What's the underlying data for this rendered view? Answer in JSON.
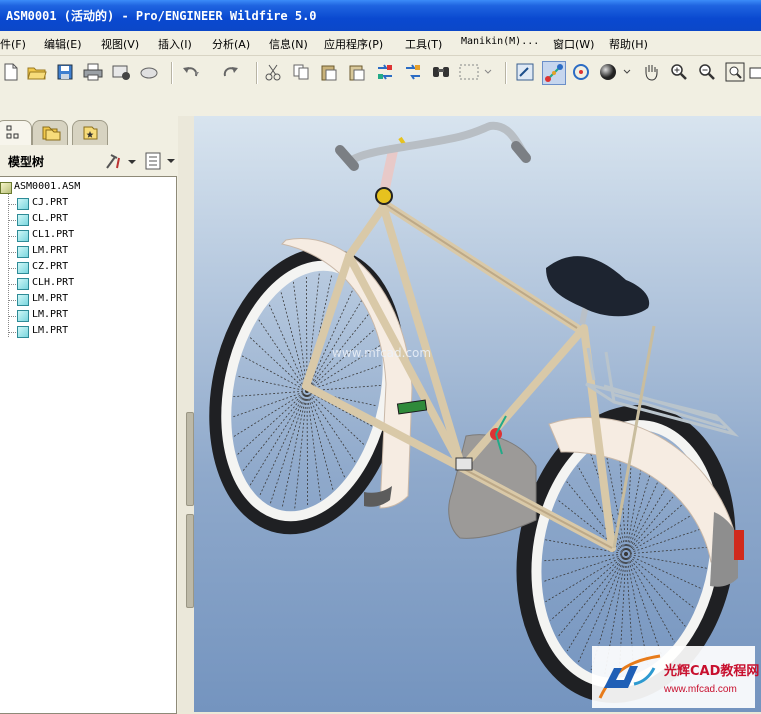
{
  "window": {
    "title": "ASM0001 (活动的) - Pro/ENGINEER Wildfire 5.0"
  },
  "menu": {
    "file": "件(F)",
    "edit": "编辑(E)",
    "view": "视图(V)",
    "insert": "插入(I)",
    "analysis": "分析(A)",
    "info": "信息(N)",
    "applications": "应用程序(P)",
    "tools": "工具(T)",
    "manikin": "Manikin(M)...",
    "window": "窗口(W)",
    "help": "帮助(H)"
  },
  "toolbar": {
    "icons": [
      "new-file-icon",
      "open-folder-icon",
      "save-icon",
      "print-icon",
      "send-mail-icon",
      "regenerate-icon",
      "undo-icon",
      "redo-icon",
      "cut-icon",
      "copy-icon",
      "paste-icon",
      "paste-special-icon",
      "regenerate-model-icon",
      "regenerate-manager-icon",
      "find-icon",
      "select-box-icon",
      "repaint-icon",
      "spin-center-icon",
      "orient-mode-icon",
      "shading-icon",
      "pan-icon",
      "zoom-in-icon",
      "zoom-out-icon",
      "refit-icon",
      "saved-views-icon"
    ]
  },
  "model_tree": {
    "header": "模型树",
    "root": "ASM0001.ASM",
    "items": [
      "CJ.PRT",
      "CL.PRT",
      "CL1.PRT",
      "LM.PRT",
      "CZ.PRT",
      "CLH.PRT",
      "LM.PRT",
      "LM.PRT",
      "LM.PRT"
    ]
  },
  "graphics": {
    "watermark": "www.mfcad.com",
    "logo_name": "光辉CAD教程网",
    "logo_url": "www.mfcad.com"
  },
  "colors": {
    "titlebar": "#0b47c8",
    "frame": "#d9c9a8",
    "saddle": "#1d2430",
    "rim": "#f4f4f2",
    "tire": "#1f2023",
    "viewport_top": "#d8e4ef",
    "viewport_bottom": "#7494bf",
    "logo_red": "#c8102e"
  }
}
